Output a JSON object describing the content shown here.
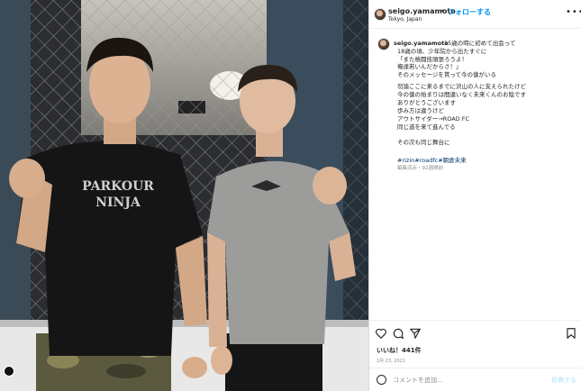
{
  "post": {
    "username": "seigo.yamamoto",
    "dot": "•",
    "follow_label": "フォローする",
    "location": "Tokyo, Japan",
    "more_label": "•••"
  },
  "caption": {
    "username": "seigo.yamamoto",
    "lines": [
      "15歳の時に初めて出会って",
      "18歳の頃、少年院から出たすぐに",
      "「また格闘技頑張ろうよ！",
      "俺達若いんだからさ！」",
      "そのメッセージを貰って今の僕がいる",
      "",
      "勿論ここに来るまでに沢山の人に支えられたけど",
      "今の僕の始まりは間違いなく未来くんのお陰です",
      "ありがとうございます",
      "歩み方は違うけど",
      "アウトサイダー→ROAD FC",
      "同じ道を来て進んでる",
      "",
      "その次も同じ舞台に"
    ],
    "hashtags": [
      "#rizin",
      "#roadfc",
      "#朝倉未来"
    ],
    "meta": "編集済み・92週間前"
  },
  "actions": {
    "likes": "いいね！441件",
    "date": "1月 23, 2021"
  },
  "comment": {
    "placeholder": "コメントを追加...",
    "post_label": "投稿する"
  },
  "photo": {
    "shirt_left_line1": "PARKOUR",
    "shirt_left_line2": "NINJA"
  },
  "colors": {
    "accent": "#0095f6",
    "hashtag": "#00376b",
    "muted": "#8e8e8e"
  }
}
